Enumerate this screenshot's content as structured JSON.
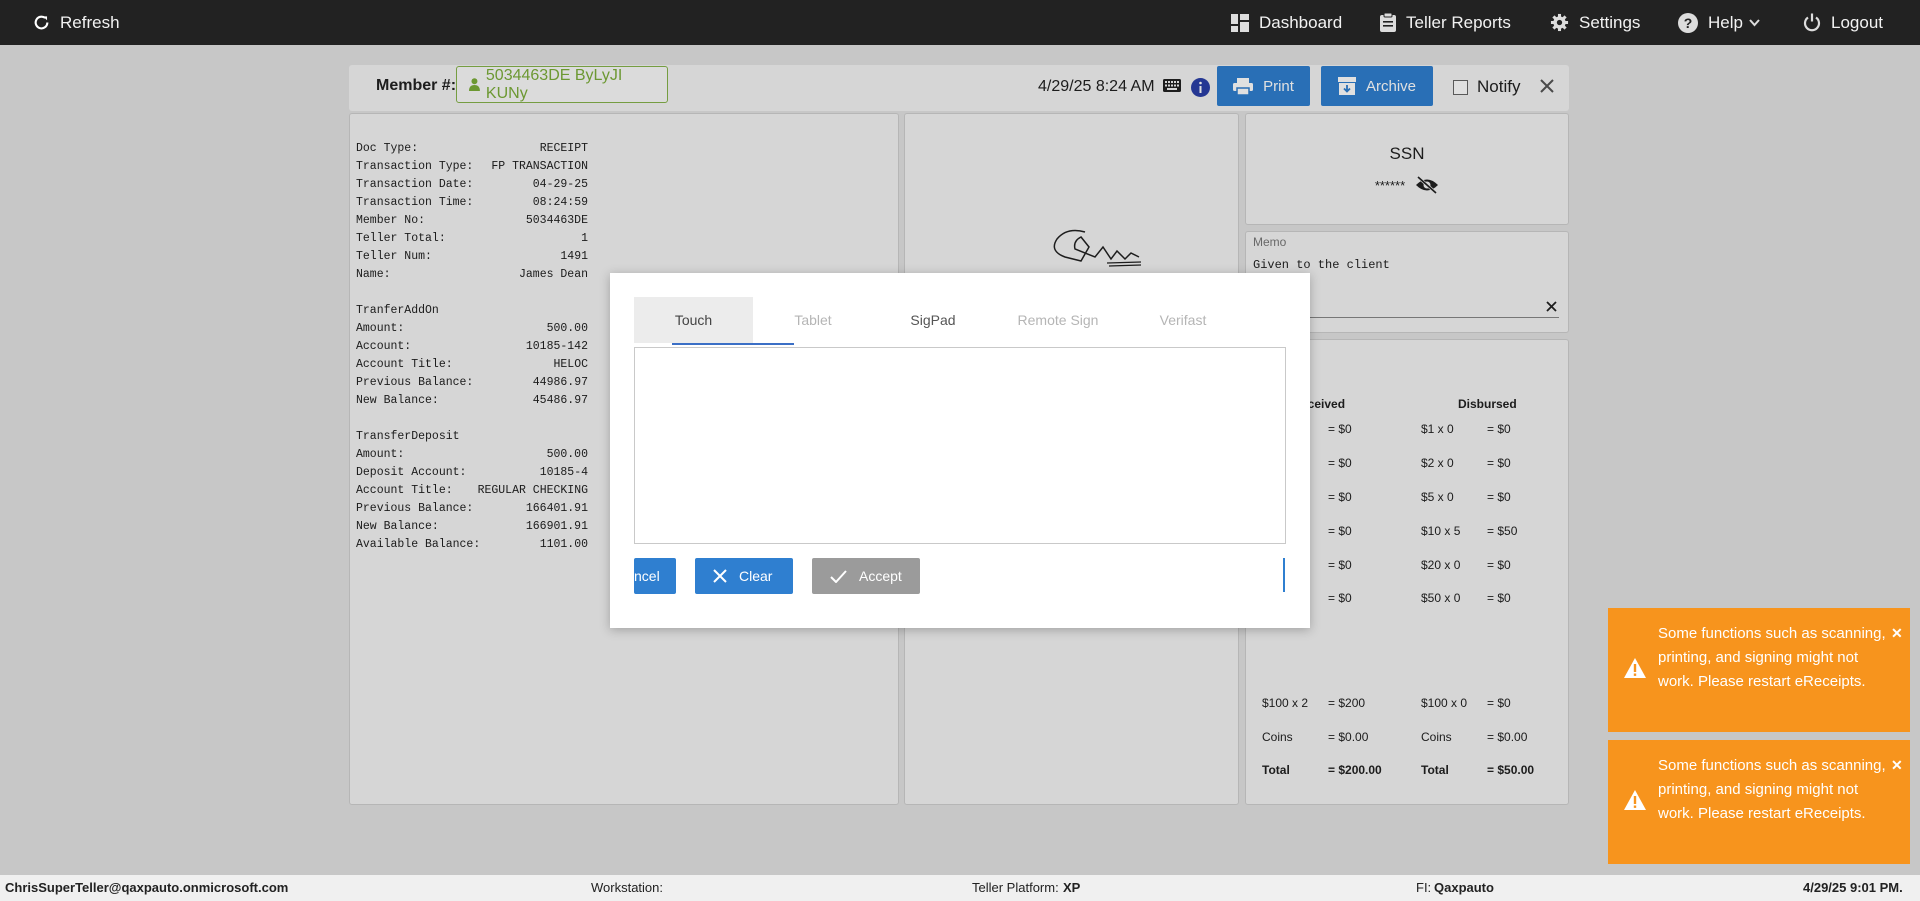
{
  "topbar": {
    "refresh": "Refresh",
    "dashboard": "Dashboard",
    "teller_reports": "Teller Reports",
    "settings": "Settings",
    "help": "Help",
    "logout": "Logout"
  },
  "member_bar": {
    "label": "Member #:",
    "member": "5034463DE ByLyJI KUNy",
    "datetime": "4/29/25 8:24 AM",
    "print": "Print",
    "archive": "Archive",
    "notify": "Notify"
  },
  "receipt": {
    "lines1": [
      [
        "Doc Type:",
        "RECEIPT"
      ],
      [
        "Transaction Type:",
        "FP TRANSACTION"
      ],
      [
        "Transaction Date:",
        "04-29-25"
      ],
      [
        "Transaction Time:",
        "08:24:59"
      ],
      [
        "Member No:",
        "5034463DE"
      ],
      [
        "Teller Total:",
        "1"
      ],
      [
        "Teller Num:",
        "1491"
      ],
      [
        "Name:",
        "James Dean"
      ]
    ],
    "section2": "TranferAddOn",
    "lines2": [
      [
        "Amount:",
        "500.00"
      ],
      [
        "Account:",
        "10185-142"
      ],
      [
        "Account Title:",
        "HELOC"
      ],
      [
        "Previous Balance:",
        "44986.97"
      ],
      [
        "New Balance:",
        "45486.97"
      ]
    ],
    "section3": "TransferDeposit",
    "lines3": [
      [
        "Amount:",
        "500.00"
      ],
      [
        "Deposit Account:",
        "10185-4"
      ],
      [
        "Account Title:",
        "REGULAR CHECKING"
      ],
      [
        "Previous Balance:",
        "166401.91"
      ],
      [
        "New Balance:",
        "166901.91"
      ],
      [
        "Available Balance:",
        "1101.00"
      ]
    ]
  },
  "ssn": {
    "title": "SSN",
    "value": "******"
  },
  "memo": {
    "label": "Memo",
    "text": "Given to the client"
  },
  "cash": {
    "received_header": "eceived",
    "disbursed_header": "Disbursed",
    "received": [
      "= $0",
      "= $0",
      "= $0",
      "= $0",
      "= $0",
      "= $0"
    ],
    "hundred_recv": "$100 x 2",
    "hundred_recv_total": "= $200",
    "coins_recv": "Coins",
    "coins_recv_total": "= $0.00",
    "total_recv": "Total",
    "total_recv_value": "= $200.00",
    "disbursed": [
      [
        "$1 x 0",
        "= $0"
      ],
      [
        "$2 x 0",
        "= $0"
      ],
      [
        "$5 x 0",
        "= $0"
      ],
      [
        "$10 x 5",
        "= $50"
      ],
      [
        "$20 x 0",
        "= $0"
      ],
      [
        "$50 x 0",
        "= $0"
      ],
      [
        "$100 x 0",
        "= $0"
      ],
      [
        "Coins",
        "= $0.00"
      ],
      [
        "Total",
        "= $50.00"
      ]
    ]
  },
  "modal": {
    "tabs": [
      "Touch",
      "Tablet",
      "SigPad",
      "Remote Sign",
      "Verifast"
    ],
    "cancel": "ncel",
    "clear": "Clear",
    "accept": "Accept"
  },
  "toasts": [
    "Some functions such as scanning, printing, and signing might not work. Please restart eReceipts.",
    "Some functions such as scanning, printing, and signing might not work. Please restart eReceipts."
  ],
  "footer": {
    "user": "ChrisSuperTeller@qaxpauto.onmicrosoft.com",
    "workstation_label": "Workstation:",
    "platform_label": "Teller Platform:",
    "platform_value": "XP",
    "fi_label": "FI:",
    "fi_value": "Qaxpauto",
    "datetime": "4/29/25 9:01 PM."
  },
  "colors": {
    "topbar": "#222222",
    "accent_blue": "#2f7fd0",
    "member_green": "#7cae3a",
    "toast_orange": "#f7941d"
  }
}
